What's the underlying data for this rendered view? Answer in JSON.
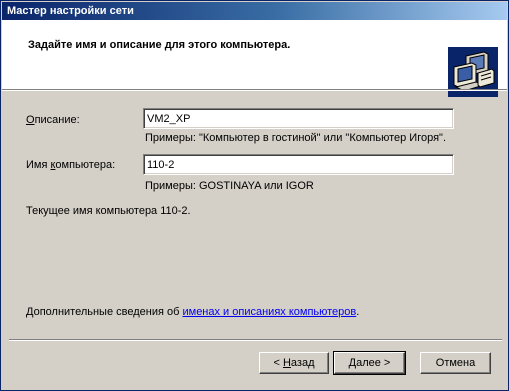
{
  "window": {
    "title": "Мастер настройки сети"
  },
  "header": {
    "title": "Задайте имя и описание для этого компьютера."
  },
  "form": {
    "description": {
      "label_mnemonic": "О",
      "label_rest": "писание:",
      "value": "VM2_XP",
      "hint": "Примеры: \"Компьютер в гостиной\" или \"Компьютер Игоря\"."
    },
    "computer_name": {
      "label_pre": "Имя ",
      "label_mnemonic": "к",
      "label_rest": "омпьютера:",
      "value": "110-2",
      "hint": "Примеры: GOSTINAYA или IGOR"
    },
    "current_name": "Текущее имя компьютера 110-2."
  },
  "more_info": {
    "prefix": "Дополнительные сведения об ",
    "link": "именах и описаниях компьютеров",
    "suffix": "."
  },
  "buttons": {
    "back": {
      "prefix": "< ",
      "mnemonic": "Н",
      "rest": "азад"
    },
    "next": {
      "mnemonic": "Д",
      "rest": "алее",
      "suffix": " >"
    },
    "cancel": "Отмена"
  },
  "colors": {
    "titlebar_start": "#0a246a",
    "titlebar_end": "#a6caf0",
    "dialog_bg": "#d4d0c8",
    "link": "#0000ee"
  },
  "icons": {
    "wizard": "network-computers-icon"
  }
}
